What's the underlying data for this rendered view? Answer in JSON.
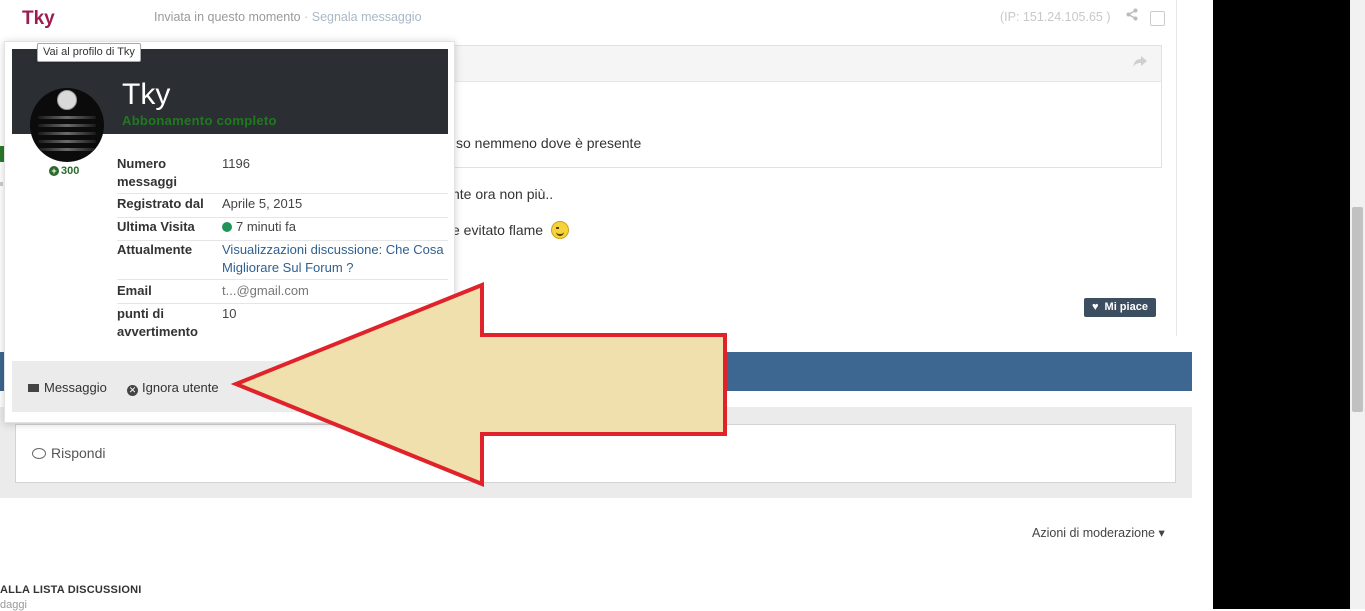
{
  "post": {
    "author": "Tky",
    "sent_label": "Inviata in questo momento",
    "separator": " · ",
    "report_label": "Segnala messaggio",
    "ip_text": "(IP: 151.24.105.65 )",
    "quote_text": "so nemmeno dove è presente",
    "line1": "nte ora non più..",
    "line2": "e evitato flame",
    "like_label": "Mi piace"
  },
  "hovercard": {
    "tooltip": "Vai al profilo di Tky",
    "name": "Tky",
    "group": "Abbonamento completo",
    "reputation": "300",
    "rows": [
      {
        "label": "Numero messaggi",
        "value": "1196"
      },
      {
        "label": "Registrato dal",
        "value": "Aprile 5, 2015"
      },
      {
        "label": "Ultima Visita",
        "value": "7 minuti fa"
      },
      {
        "label": "Attualmente",
        "value": "Visualizzazioni discussione: Che Cosa Migliorare Sul Forum ?"
      },
      {
        "label": "Email",
        "value": "t...@gmail.com"
      },
      {
        "label": "punti di avvertimento",
        "value": "10"
      }
    ],
    "message_button": "Messaggio",
    "ignore_button": "Ignora utente"
  },
  "reply": {
    "label": "Rispondi"
  },
  "moderation": {
    "label": "Azioni di moderazione"
  },
  "back": {
    "label": "ALLA LISTA DISCUSSIONI",
    "sub": "daggi"
  },
  "colors": {
    "author": "#9c1c4f",
    "blue_bar": "#3d6690",
    "arrow_fill": "#efe0ae",
    "arrow_stroke": "#e0222b",
    "banner": "#2b2e33",
    "group_green": "#1f7a1f"
  },
  "icons": {
    "share": "share-icon",
    "heart": "heart-icon",
    "envelope": "envelope-icon",
    "ignore": "times-circle-icon",
    "reply": "speech-bubble-icon",
    "caret": "caret-down-icon",
    "online": "online-dot-icon"
  }
}
